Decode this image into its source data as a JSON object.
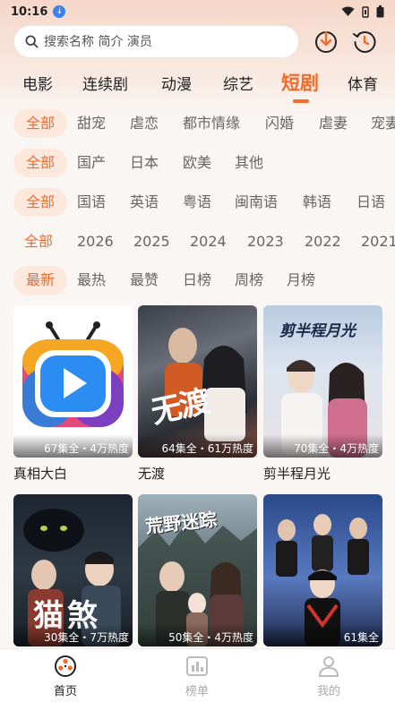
{
  "status": {
    "time": "10:16"
  },
  "search": {
    "placeholder": "搜索名称 简介 演员"
  },
  "categories": [
    {
      "label": "电影"
    },
    {
      "label": "连续剧"
    },
    {
      "label": "动漫"
    },
    {
      "label": "综艺"
    },
    {
      "label": "短剧",
      "active": true
    },
    {
      "label": "体育"
    }
  ],
  "filters": {
    "genre": [
      "全部",
      "甜宠",
      "虐恋",
      "都市情缘",
      "闪婚",
      "虐妻",
      "宠妻"
    ],
    "region": [
      "全部",
      "国产",
      "日本",
      "欧美",
      "其他"
    ],
    "language": [
      "全部",
      "国语",
      "英语",
      "粤语",
      "闽南语",
      "韩语",
      "日语"
    ],
    "year": [
      "全部",
      "2026",
      "2025",
      "2024",
      "2023",
      "2022",
      "2021"
    ],
    "sort": [
      "最新",
      "最热",
      "最赞",
      "日榜",
      "周榜",
      "月榜"
    ]
  },
  "cards": [
    {
      "title": "真相大白",
      "meta": "67集全・4万热度",
      "poster_text": ""
    },
    {
      "title": "无渡",
      "meta": "64集全・61万热度",
      "poster_text": "无渡"
    },
    {
      "title": "剪半程月光",
      "meta": "70集全・4万热度",
      "poster_text": "剪半程月光"
    },
    {
      "title": "",
      "meta": "30集全・7万热度",
      "poster_text": "猫煞"
    },
    {
      "title": "",
      "meta": "50集全・4万热度",
      "poster_text": "荒野迷踪"
    },
    {
      "title": "",
      "meta": "61集全",
      "poster_text": ""
    }
  ],
  "nav": [
    {
      "label": "首页",
      "active": true
    },
    {
      "label": "榜单"
    },
    {
      "label": "我的"
    }
  ],
  "colors": {
    "accent": "#f26b2a",
    "chip_bg": "#fde8dd"
  }
}
